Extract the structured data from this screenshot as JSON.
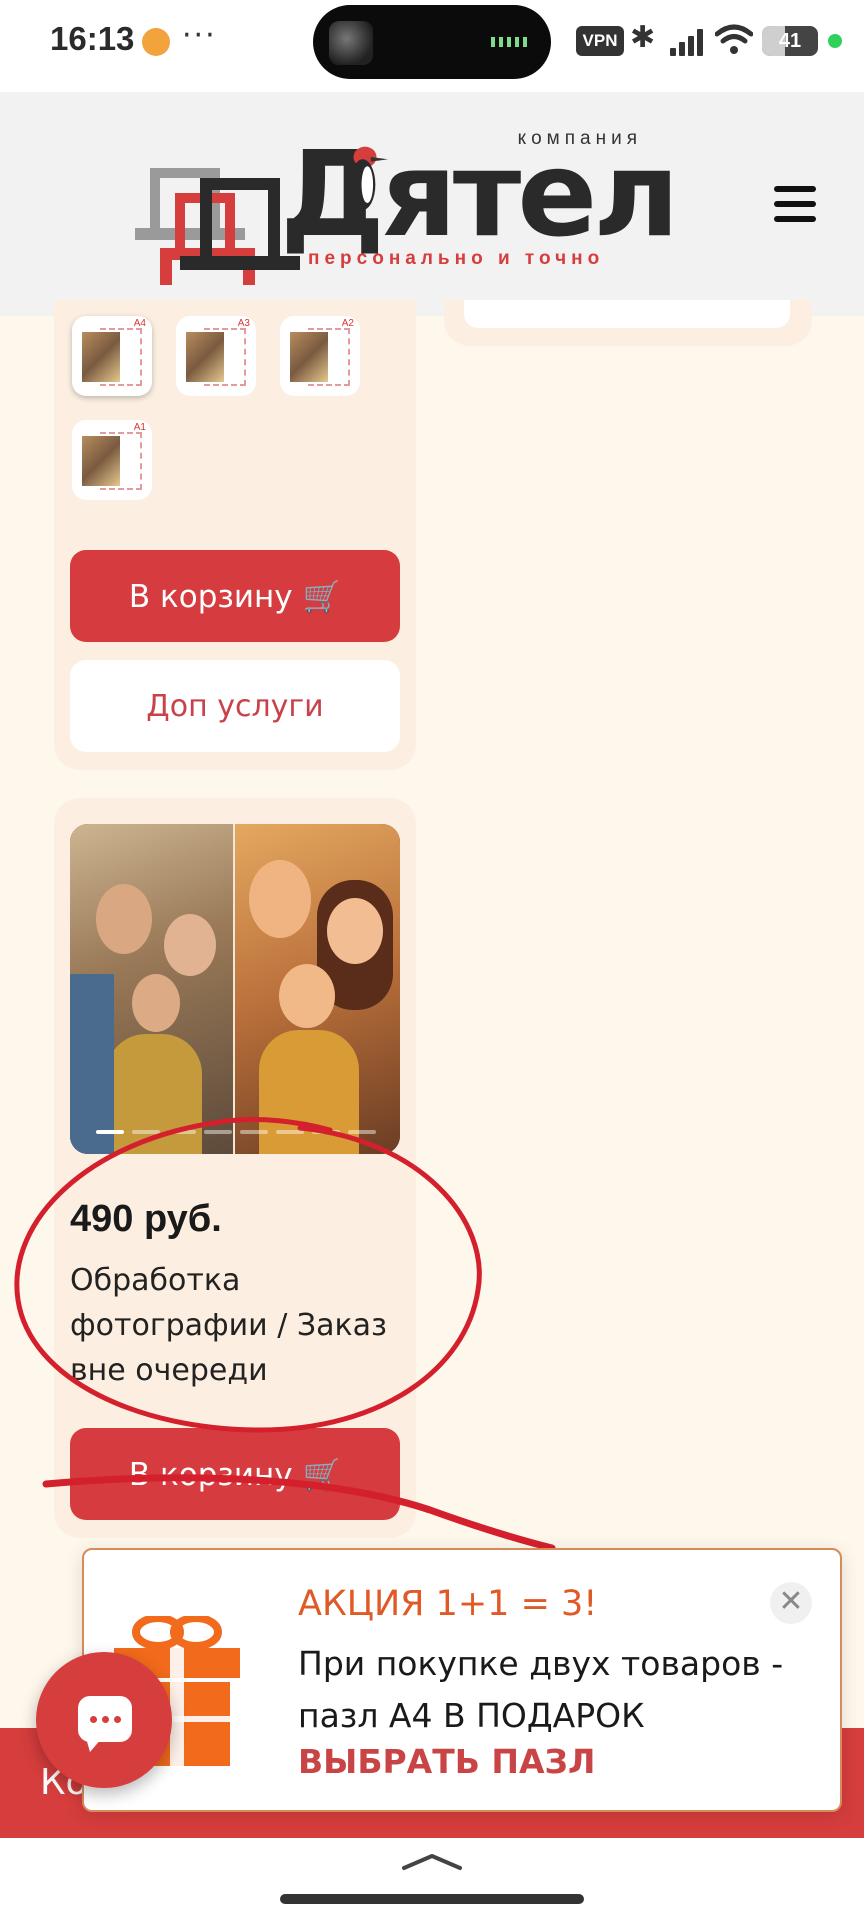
{
  "status_bar": {
    "time": "16:13",
    "more": "···",
    "vpn": "VPN",
    "battery_level": "41"
  },
  "header": {
    "logo_word": "Дятел",
    "logo_company": "компания",
    "logo_tagline": "персонально и точно"
  },
  "size_options": [
    {
      "label": "A4",
      "selected": true
    },
    {
      "label": "A3",
      "selected": false
    },
    {
      "label": "A2",
      "selected": false
    },
    {
      "label": "A1",
      "selected": false
    }
  ],
  "top_card": {
    "cart_label": "В корзину 🛒",
    "extra_label": "Доп услуги"
  },
  "product": {
    "price": "490 руб.",
    "description": "Обработка фотографии / Заказ вне очереди",
    "cart_label": "В корзину 🛒"
  },
  "promo": {
    "title": "АКЦИЯ 1+1 = 3!",
    "text": "При покупке двух товаров - пазл А4 В ПОДАРОК",
    "link": "ВЫБРАТЬ ПАЗЛ",
    "close": "✕"
  },
  "bottom_bar": {
    "text": "Ко"
  },
  "colors": {
    "accent_red": "#d63d3d",
    "promo_orange": "#e05a27",
    "card_bg": "#fcefe1",
    "page_bg": "#fdf7ec"
  }
}
